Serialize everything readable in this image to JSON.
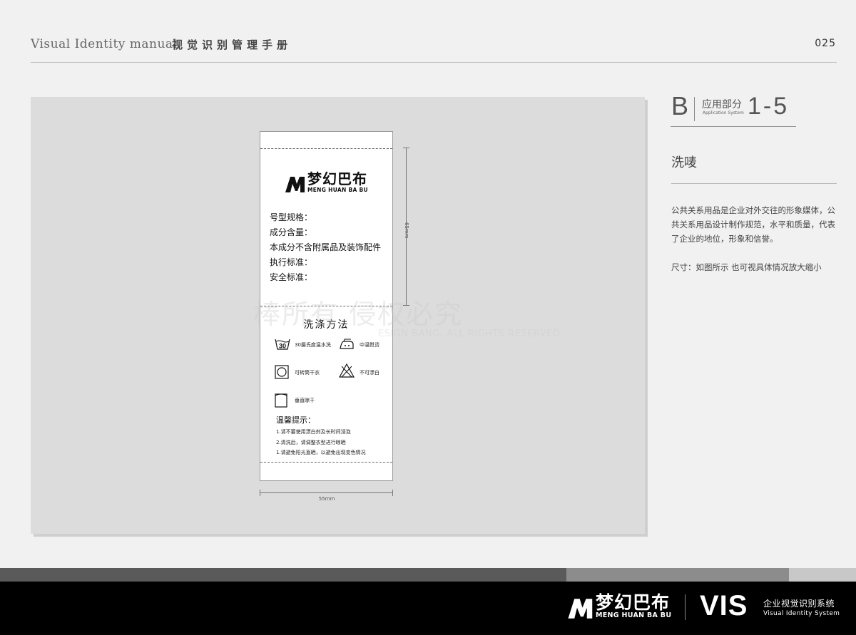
{
  "header": {
    "title_en": "Visual Identity  manual",
    "title_zh": "视觉识别管理手册",
    "page_number": "025"
  },
  "label": {
    "brand_cn": "梦幻巴布",
    "brand_en": "MENG HUAN BA BU",
    "fields": [
      "号型规格：",
      "成分含量：",
      "本成分不含附属品及装饰配件",
      "执行标准：",
      "安全标准："
    ],
    "wash_title": "洗涤方法",
    "symbols": {
      "wash30_value": "30",
      "wash30": "30摄氏度温水洗",
      "iron": "中温熨烫",
      "tumble": "可转筒干衣",
      "no_bleach": "不可漂白",
      "hang": "垂直晾干"
    },
    "tips_title": "温馨提示：",
    "tips": [
      "1.请不要使用漂白剂及长时间浸泡",
      "2.清洗后，请调整衣型进行晾晒",
      "1.请避免阳光直晒，以避免出现变色情况"
    ],
    "height_dim": "65mm",
    "width_dim": "55mm"
  },
  "watermark": {
    "zh": "棒所有  侵权必究",
    "en": "ESIGN BANG. ALL RIGHTS RESERVED."
  },
  "section": {
    "letter": "B",
    "name_zh": "应用部分",
    "name_en": "Application System",
    "number": "1-5"
  },
  "item": {
    "title": "洗唛",
    "desc": "公共关系用品是企业对外交往的形象媒体，公共关系用品设计制作规范，水平和质量，代表了企业的地位，形象和信誉。",
    "size": "尺寸：如图所示 也可视具体情况放大缩小"
  },
  "footer": {
    "brand_cn": "梦幻巴布",
    "brand_en": "MENG HUAN BA BU",
    "vis": "VIS",
    "zh": "企业视觉识别系统",
    "en": "Visual Identity System"
  }
}
